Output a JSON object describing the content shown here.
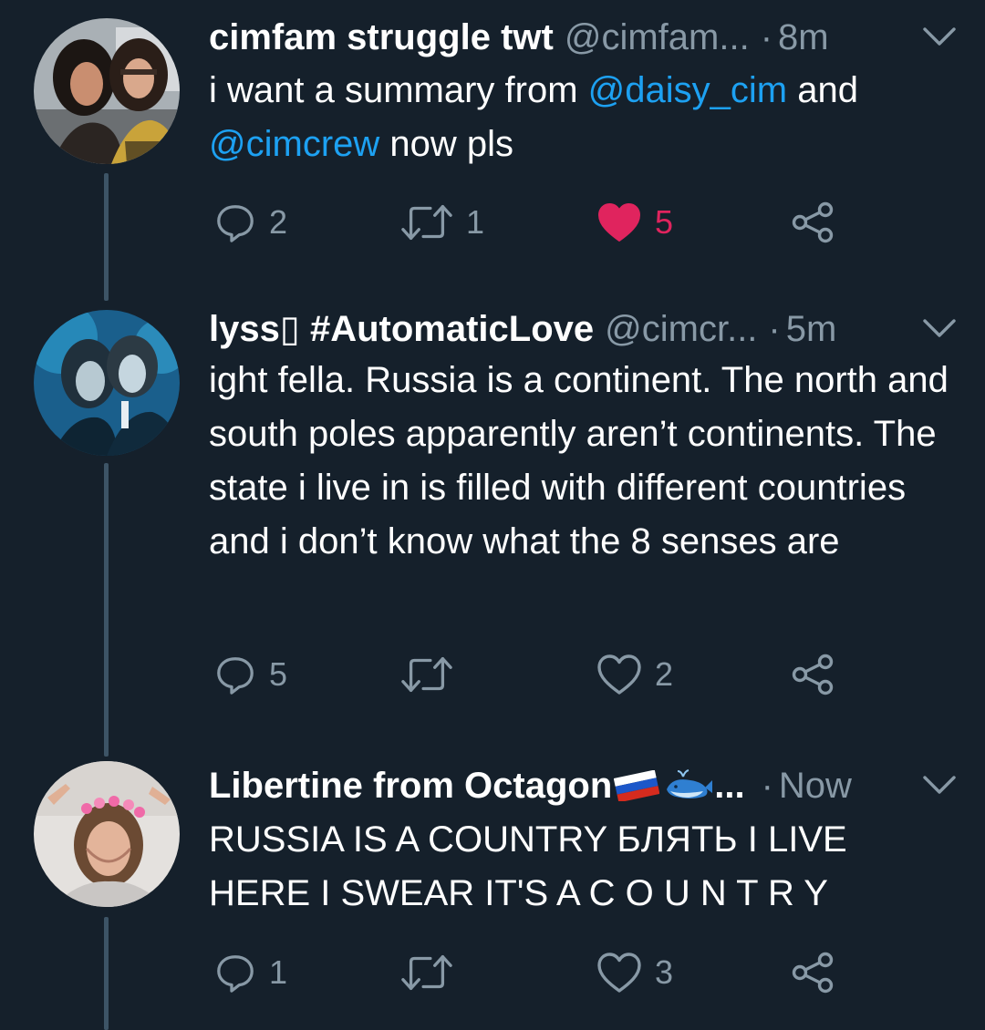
{
  "colors": {
    "background": "#15202b",
    "secondary_text": "#8899a6",
    "link": "#1da1f2",
    "like_active": "#e0245e",
    "thread_line": "#3d5466"
  },
  "tweets": [
    {
      "name": "cimfam struggle twt",
      "handle": "@cimfam...",
      "dot": "·",
      "time": "8m",
      "text_parts": [
        "i want a summary from ",
        "@daisy_cim",
        " and ",
        "@cimcrew",
        " now pls"
      ],
      "replies": "2",
      "retweets": "1",
      "likes": "5",
      "liked": true,
      "icons": [
        "reply-icon",
        "retweet-icon",
        "heart-filled-icon",
        "share-icon",
        "chevron-down-icon"
      ]
    },
    {
      "name": "lyss▯ #AutomaticLove",
      "handle": "@cimcr...",
      "dot": "·",
      "time": "5m",
      "text": "ight fella. Russia is a continent. The north and south poles apparently aren’t continents. The state i live in is filled with different countries and i don’t know what the 8 senses are",
      "replies": "5",
      "retweets": "",
      "likes": "2",
      "liked": false,
      "icons": [
        "reply-icon",
        "retweet-icon",
        "heart-icon",
        "share-icon",
        "chevron-down-icon"
      ]
    },
    {
      "name": "Libertine from Octagon",
      "name_suffix": "...",
      "dot": "·",
      "time": "Now",
      "text": "RUSSIA IS A COUNTRY БЛЯТЬ I LIVE HERE I SWEAR IT'S A  C O U N T R Y",
      "replies": "1",
      "retweets": "",
      "likes": "3",
      "liked": false,
      "icons": [
        "russia-flag-icon",
        "whale-icon",
        "reply-icon",
        "retweet-icon",
        "heart-icon",
        "share-icon",
        "chevron-down-icon"
      ]
    }
  ]
}
